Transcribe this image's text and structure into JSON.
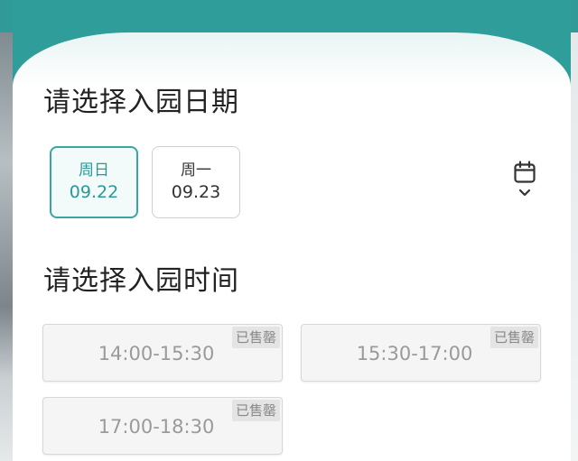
{
  "date_section": {
    "title": "请选择入园日期",
    "dates": [
      {
        "weekday": "周日",
        "date": "09.22",
        "selected": true
      },
      {
        "weekday": "周一",
        "date": "09.23",
        "selected": false
      }
    ],
    "calendar_icon": "calendar-icon",
    "expand_icon": "chevron-down-icon"
  },
  "time_section": {
    "title": "请选择入园时间",
    "slots": [
      {
        "time": "14:00-15:30",
        "status": "已售罄"
      },
      {
        "time": "15:30-17:00",
        "status": "已售罄"
      },
      {
        "time": "17:00-18:30",
        "status": "已售罄"
      }
    ]
  },
  "colors": {
    "accent": "#2f9e9b",
    "selected_text": "#2a9a97",
    "soldout_badge_bg": "#e4e4e4"
  }
}
